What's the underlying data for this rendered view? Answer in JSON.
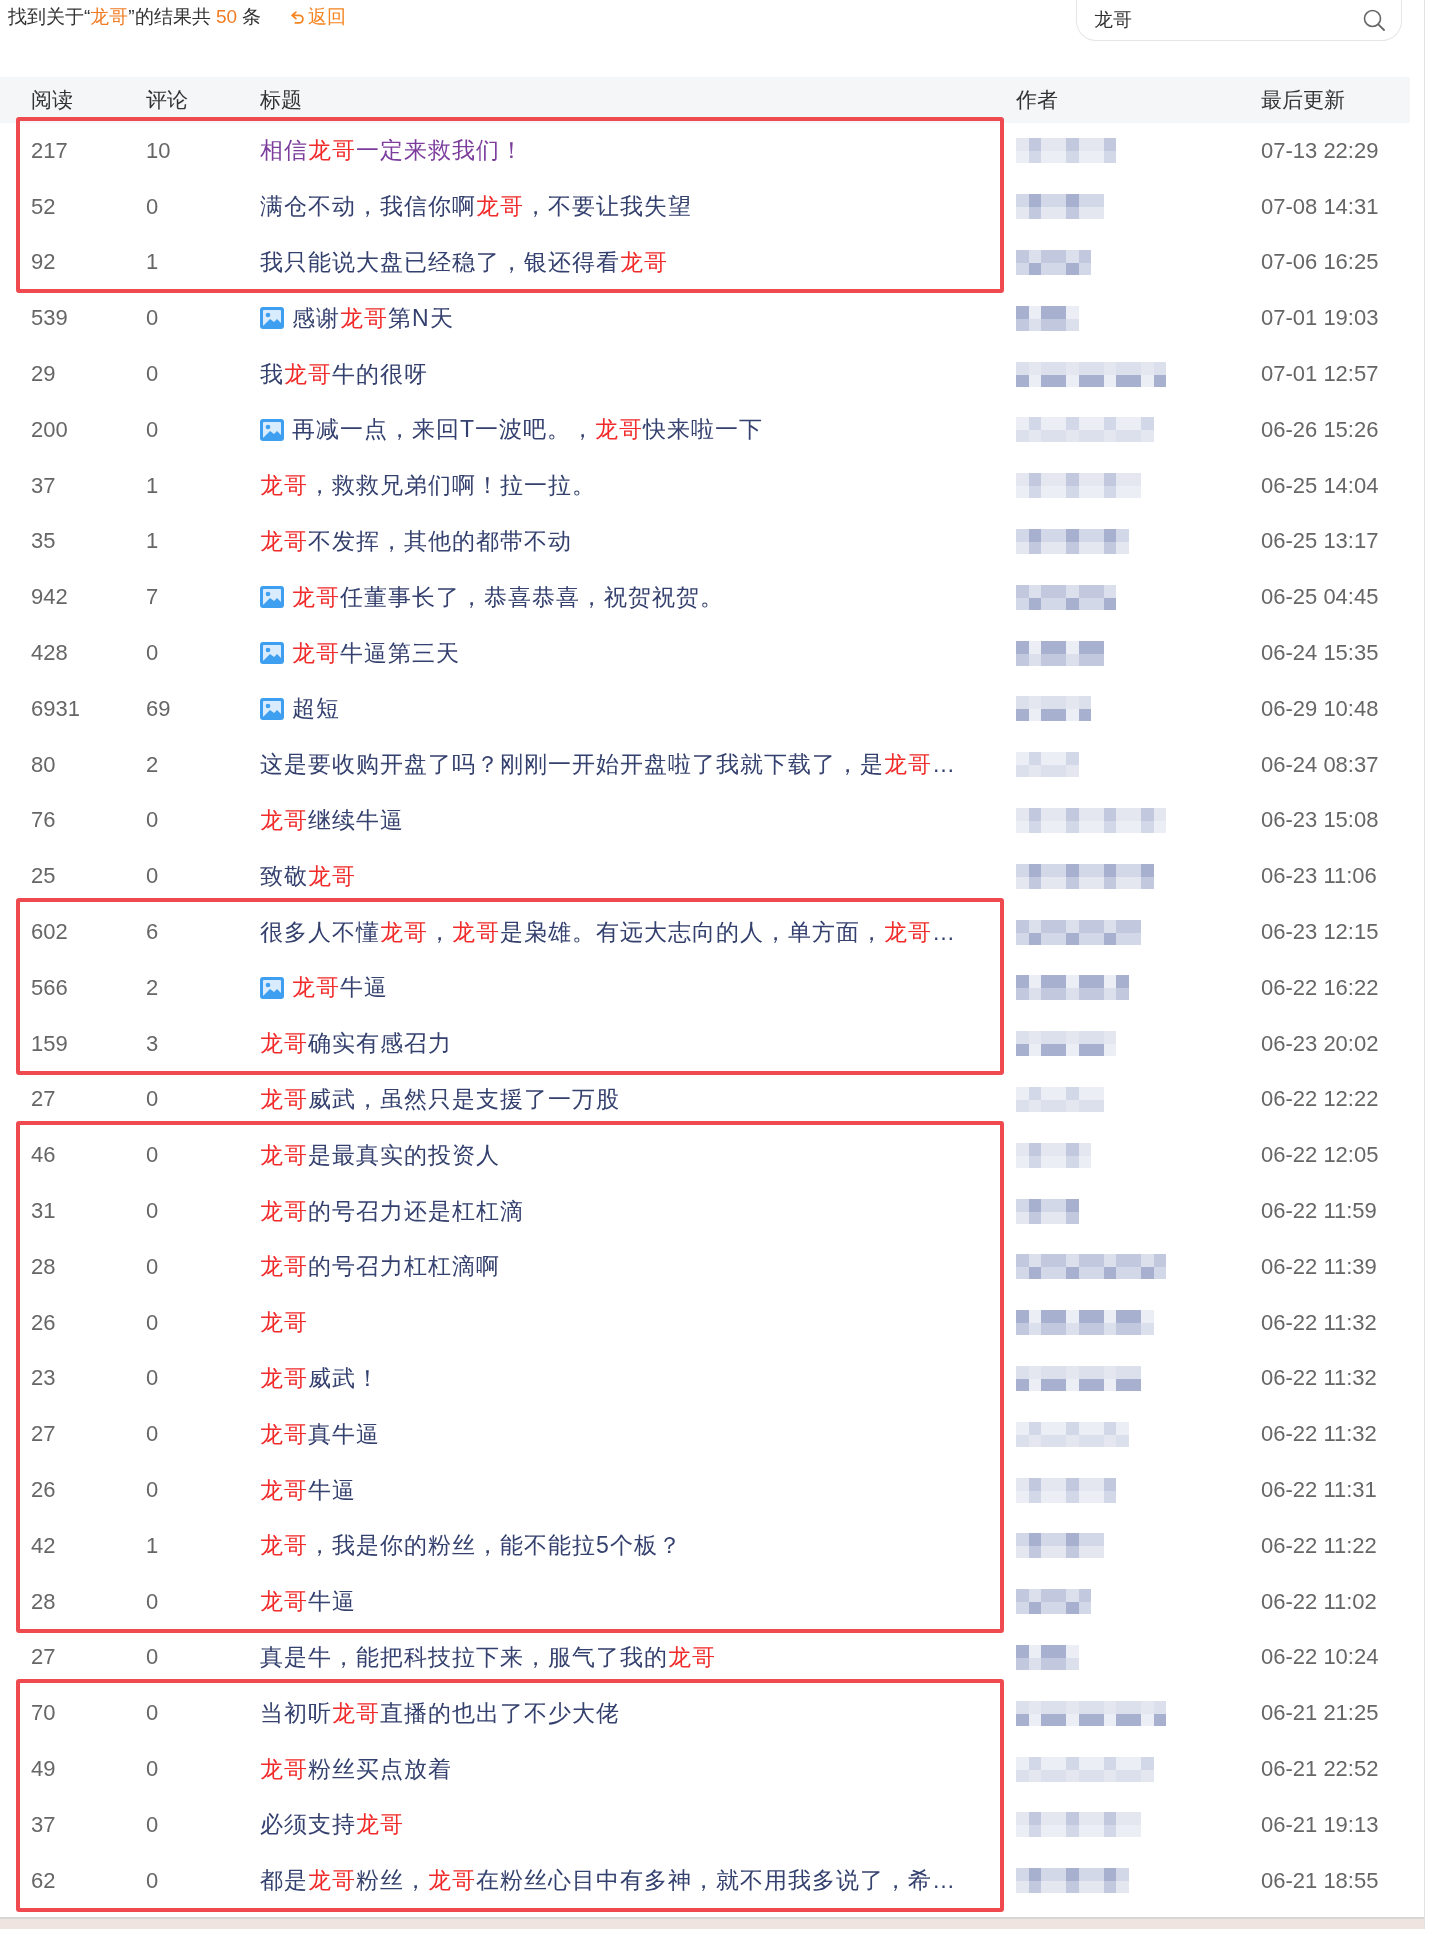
{
  "header": {
    "summary": [
      {
        "text": "找到关于“",
        "highlight": false
      },
      {
        "text": "龙哥",
        "highlight": true
      },
      {
        "text": "”的结果共 ",
        "highlight": false
      },
      {
        "text": "50",
        "highlight": true
      },
      {
        "text": " 条",
        "highlight": false
      }
    ],
    "back_link": "返回"
  },
  "search": {
    "value": "龙哥"
  },
  "table": {
    "columns": [
      "阅读",
      "评论",
      "标题",
      "作者",
      "最后更新"
    ],
    "row_groups": [
      {
        "highlighted": true,
        "rows": [
          {
            "reads": "217",
            "comments": "10",
            "has_image": false,
            "visited": true,
            "title": [
              {
                "text": "相信",
                "highlight": false
              },
              {
                "text": "龙哥",
                "highlight": true
              },
              {
                "text": "一定来救我们！",
                "highlight": false
              }
            ],
            "updated": "07-13 22:29"
          },
          {
            "reads": "52",
            "comments": "0",
            "has_image": false,
            "visited": false,
            "title": [
              {
                "text": "满仓不动，我信你啊",
                "highlight": false
              },
              {
                "text": "龙哥",
                "highlight": true
              },
              {
                "text": "，不要让我失望",
                "highlight": false
              }
            ],
            "updated": "07-08 14:31"
          },
          {
            "reads": "92",
            "comments": "1",
            "has_image": false,
            "visited": false,
            "title": [
              {
                "text": "我只能说大盘已经稳了，银还得看",
                "highlight": false
              },
              {
                "text": "龙哥",
                "highlight": true
              }
            ],
            "updated": "07-06 16:25"
          }
        ]
      },
      {
        "highlighted": false,
        "rows": [
          {
            "reads": "539",
            "comments": "0",
            "has_image": true,
            "visited": false,
            "title": [
              {
                "text": "感谢",
                "highlight": false
              },
              {
                "text": "龙哥",
                "highlight": true
              },
              {
                "text": "第N天",
                "highlight": false
              }
            ],
            "updated": "07-01 19:03"
          },
          {
            "reads": "29",
            "comments": "0",
            "has_image": false,
            "visited": false,
            "title": [
              {
                "text": "我",
                "highlight": false
              },
              {
                "text": "龙哥",
                "highlight": true
              },
              {
                "text": "牛的很呀",
                "highlight": false
              }
            ],
            "updated": "07-01 12:57"
          },
          {
            "reads": "200",
            "comments": "0",
            "has_image": true,
            "visited": false,
            "title": [
              {
                "text": "再减一点，来回T一波吧。，",
                "highlight": false
              },
              {
                "text": "龙哥",
                "highlight": true
              },
              {
                "text": "快来啦一下",
                "highlight": false
              }
            ],
            "updated": "06-26 15:26"
          },
          {
            "reads": "37",
            "comments": "1",
            "has_image": false,
            "visited": false,
            "title": [
              {
                "text": "龙哥",
                "highlight": true
              },
              {
                "text": "，救救兄弟们啊！拉一拉。",
                "highlight": false
              }
            ],
            "updated": "06-25 14:04"
          },
          {
            "reads": "35",
            "comments": "1",
            "has_image": false,
            "visited": false,
            "title": [
              {
                "text": "龙哥",
                "highlight": true
              },
              {
                "text": "不发挥，其他的都带不动",
                "highlight": false
              }
            ],
            "updated": "06-25 13:17"
          },
          {
            "reads": "942",
            "comments": "7",
            "has_image": true,
            "visited": false,
            "title": [
              {
                "text": "龙哥",
                "highlight": true
              },
              {
                "text": "任董事长了，恭喜恭喜，祝贺祝贺。",
                "highlight": false
              }
            ],
            "updated": "06-25 04:45"
          },
          {
            "reads": "428",
            "comments": "0",
            "has_image": true,
            "visited": false,
            "title": [
              {
                "text": "龙哥",
                "highlight": true
              },
              {
                "text": "牛逼第三天",
                "highlight": false
              }
            ],
            "updated": "06-24 15:35"
          },
          {
            "reads": "6931",
            "comments": "69",
            "has_image": true,
            "visited": false,
            "title": [
              {
                "text": "超短",
                "highlight": false
              }
            ],
            "updated": "06-29 10:48"
          },
          {
            "reads": "80",
            "comments": "2",
            "has_image": false,
            "visited": false,
            "title": [
              {
                "text": "这是要收购开盘了吗？刚刚一开始开盘啦了我就下载了，是",
                "highlight": false
              },
              {
                "text": "龙哥",
                "highlight": true
              },
              {
                "text": "…",
                "highlight": false
              }
            ],
            "updated": "06-24 08:37"
          },
          {
            "reads": "76",
            "comments": "0",
            "has_image": false,
            "visited": false,
            "title": [
              {
                "text": "龙哥",
                "highlight": true
              },
              {
                "text": "继续牛逼",
                "highlight": false
              }
            ],
            "updated": "06-23 15:08"
          },
          {
            "reads": "25",
            "comments": "0",
            "has_image": false,
            "visited": false,
            "title": [
              {
                "text": "致敬",
                "highlight": false
              },
              {
                "text": "龙哥",
                "highlight": true
              }
            ],
            "updated": "06-23 11:06"
          }
        ]
      },
      {
        "highlighted": true,
        "rows": [
          {
            "reads": "602",
            "comments": "6",
            "has_image": false,
            "visited": false,
            "title": [
              {
                "text": "很多人不懂",
                "highlight": false
              },
              {
                "text": "龙哥",
                "highlight": true
              },
              {
                "text": "，",
                "highlight": false
              },
              {
                "text": "龙哥",
                "highlight": true
              },
              {
                "text": "是枭雄。有远大志向的人，单方面，",
                "highlight": false
              },
              {
                "text": "龙哥",
                "highlight": true
              },
              {
                "text": "…",
                "highlight": false
              }
            ],
            "updated": "06-23 12:15"
          },
          {
            "reads": "566",
            "comments": "2",
            "has_image": true,
            "visited": false,
            "title": [
              {
                "text": "龙哥",
                "highlight": true
              },
              {
                "text": "牛逼",
                "highlight": false
              }
            ],
            "updated": "06-22 16:22"
          },
          {
            "reads": "159",
            "comments": "3",
            "has_image": false,
            "visited": false,
            "title": [
              {
                "text": "龙哥",
                "highlight": true
              },
              {
                "text": "确实有感召力",
                "highlight": false
              }
            ],
            "updated": "06-23 20:02"
          }
        ]
      },
      {
        "highlighted": false,
        "rows": [
          {
            "reads": "27",
            "comments": "0",
            "has_image": false,
            "visited": false,
            "title": [
              {
                "text": "龙哥",
                "highlight": true
              },
              {
                "text": "威武，虽然只是支援了一万股",
                "highlight": false
              }
            ],
            "updated": "06-22 12:22"
          }
        ]
      },
      {
        "highlighted": true,
        "rows": [
          {
            "reads": "46",
            "comments": "0",
            "has_image": false,
            "visited": false,
            "title": [
              {
                "text": "龙哥",
                "highlight": true
              },
              {
                "text": "是最真实的投资人",
                "highlight": false
              }
            ],
            "updated": "06-22 12:05"
          },
          {
            "reads": "31",
            "comments": "0",
            "has_image": false,
            "visited": false,
            "title": [
              {
                "text": "龙哥",
                "highlight": true
              },
              {
                "text": "的号召力还是杠杠滴",
                "highlight": false
              }
            ],
            "updated": "06-22 11:59"
          },
          {
            "reads": "28",
            "comments": "0",
            "has_image": false,
            "visited": false,
            "title": [
              {
                "text": "龙哥",
                "highlight": true
              },
              {
                "text": "的号召力杠杠滴啊",
                "highlight": false
              }
            ],
            "updated": "06-22 11:39"
          },
          {
            "reads": "26",
            "comments": "0",
            "has_image": false,
            "visited": false,
            "title": [
              {
                "text": "龙哥",
                "highlight": true
              }
            ],
            "updated": "06-22 11:32"
          },
          {
            "reads": "23",
            "comments": "0",
            "has_image": false,
            "visited": false,
            "title": [
              {
                "text": "龙哥",
                "highlight": true
              },
              {
                "text": "威武！",
                "highlight": false
              }
            ],
            "updated": "06-22 11:32"
          },
          {
            "reads": "27",
            "comments": "0",
            "has_image": false,
            "visited": false,
            "title": [
              {
                "text": "龙哥",
                "highlight": true
              },
              {
                "text": "真牛逼",
                "highlight": false
              }
            ],
            "updated": "06-22 11:32"
          },
          {
            "reads": "26",
            "comments": "0",
            "has_image": false,
            "visited": false,
            "title": [
              {
                "text": "龙哥",
                "highlight": true
              },
              {
                "text": "牛逼",
                "highlight": false
              }
            ],
            "updated": "06-22 11:31"
          },
          {
            "reads": "42",
            "comments": "1",
            "has_image": false,
            "visited": false,
            "title": [
              {
                "text": "龙哥",
                "highlight": true
              },
              {
                "text": "，我是你的粉丝，能不能拉5个板？",
                "highlight": false
              }
            ],
            "updated": "06-22 11:22"
          },
          {
            "reads": "28",
            "comments": "0",
            "has_image": false,
            "visited": false,
            "title": [
              {
                "text": "龙哥",
                "highlight": true
              },
              {
                "text": "牛逼",
                "highlight": false
              }
            ],
            "updated": "06-22 11:02"
          }
        ]
      },
      {
        "highlighted": false,
        "rows": [
          {
            "reads": "27",
            "comments": "0",
            "has_image": false,
            "visited": false,
            "title": [
              {
                "text": "真是牛，能把科技拉下来，服气了我的",
                "highlight": false
              },
              {
                "text": "龙哥",
                "highlight": true
              }
            ],
            "updated": "06-22 10:24"
          }
        ]
      },
      {
        "highlighted": true,
        "rows": [
          {
            "reads": "70",
            "comments": "0",
            "has_image": false,
            "visited": false,
            "title": [
              {
                "text": "当初听",
                "highlight": false
              },
              {
                "text": "龙哥",
                "highlight": true
              },
              {
                "text": "直播的也出了不少大佬",
                "highlight": false
              }
            ],
            "updated": "06-21 21:25"
          },
          {
            "reads": "49",
            "comments": "0",
            "has_image": false,
            "visited": false,
            "title": [
              {
                "text": "龙哥",
                "highlight": true
              },
              {
                "text": "粉丝买点放着",
                "highlight": false
              }
            ],
            "updated": "06-21 22:52"
          },
          {
            "reads": "37",
            "comments": "0",
            "has_image": false,
            "visited": false,
            "title": [
              {
                "text": "必须支持",
                "highlight": false
              },
              {
                "text": "龙哥",
                "highlight": true
              }
            ],
            "updated": "06-21 19:13"
          },
          {
            "reads": "62",
            "comments": "0",
            "has_image": false,
            "visited": false,
            "title": [
              {
                "text": "都是",
                "highlight": false
              },
              {
                "text": "龙哥",
                "highlight": true
              },
              {
                "text": "粉丝，",
                "highlight": false
              },
              {
                "text": "龙哥",
                "highlight": true
              },
              {
                "text": "在粉丝心目中有多神，就不用我多说了，希…",
                "highlight": false
              }
            ],
            "updated": "06-21 18:55"
          }
        ]
      }
    ]
  }
}
